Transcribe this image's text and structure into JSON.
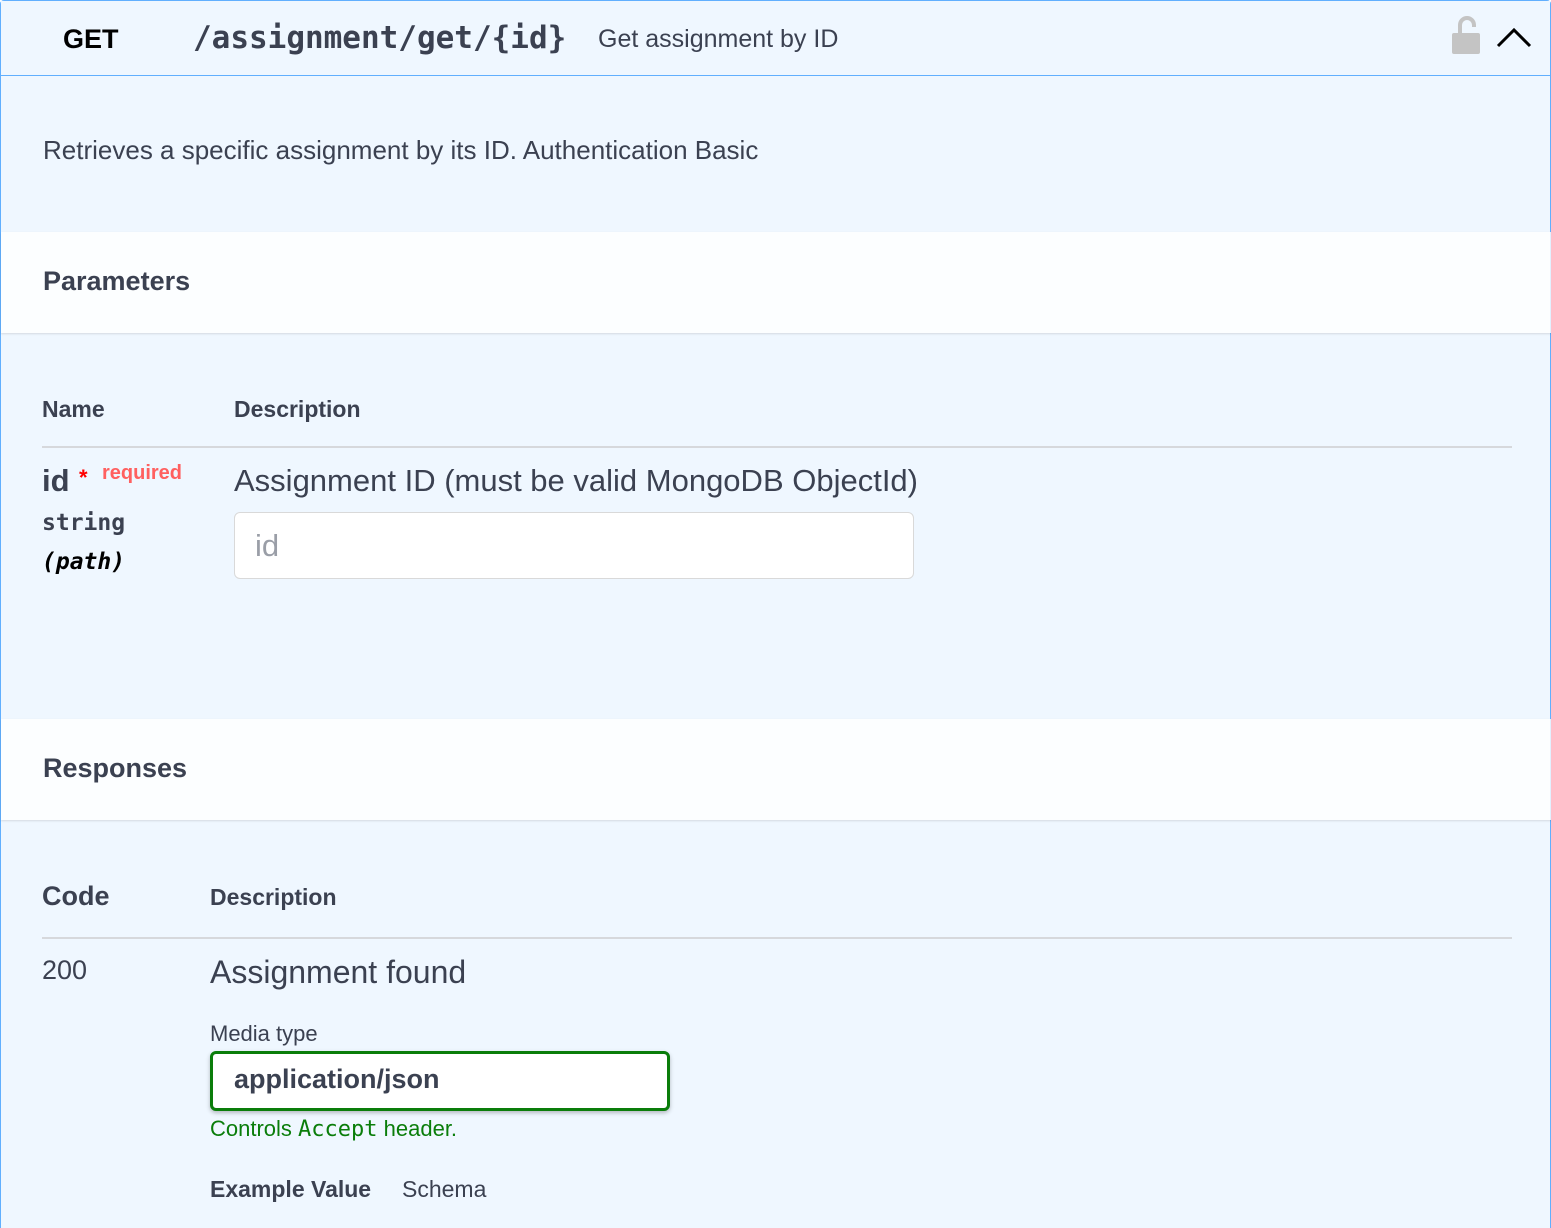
{
  "operation": {
    "method": "GET",
    "path": "/assignment/get/{id}",
    "summary": "Get assignment by ID",
    "description": "Retrieves a specific assignment by its ID. Authentication Basic",
    "method_color": "#61affe"
  },
  "parameters": {
    "title": "Parameters",
    "col_name": "Name",
    "col_description": "Description",
    "items": [
      {
        "name": "id",
        "required_star": "*",
        "required_label": "required",
        "type": "string",
        "in": "(path)",
        "description": "Assignment ID (must be valid MongoDB ObjectId)",
        "placeholder": "id",
        "value": ""
      }
    ]
  },
  "responses": {
    "title": "Responses",
    "col_code": "Code",
    "col_description": "Description",
    "items": [
      {
        "code": "200",
        "description": "Assignment found",
        "media_type_label": "Media type",
        "media_type": "application/json",
        "controls_prefix": "Controls ",
        "controls_code": "Accept",
        "controls_suffix": " header.",
        "tab_example": "Example Value",
        "tab_schema": "Schema"
      }
    ]
  }
}
